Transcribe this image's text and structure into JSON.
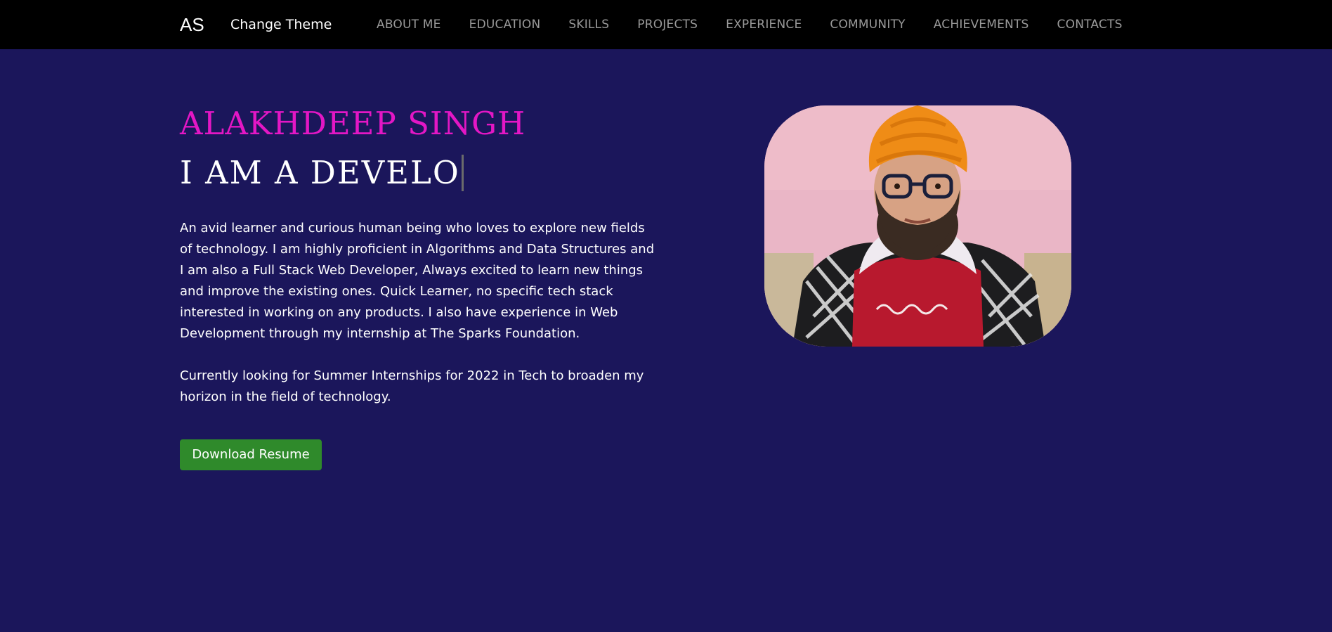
{
  "navbar": {
    "brand": "AS",
    "theme_toggle": "Change Theme",
    "links": [
      "ABOUT ME",
      "EDUCATION",
      "SKILLS",
      "PROJECTS",
      "EXPERIENCE",
      "COMMUNITY",
      "ACHIEVEMENTS",
      "CONTACTS"
    ]
  },
  "hero": {
    "name": "ALAKHDEEP SINGH",
    "typing_text": "I AM A DEVELO",
    "bio": "An avid learner and curious human being who loves to explore new fields of technology. I am highly proficient in Algorithms and Data Structures and I am also a Full Stack Web Developer, Always excited to learn new things and improve the existing ones. Quick Learner, no specific tech stack interested in working on any products. I also have experience in Web Development through my internship at The Sparks Foundation.",
    "seeking": "Currently looking for Summer Internships for 2022 in Tech to broaden my horizon in the field of technology.",
    "resume_button": "Download Resume"
  },
  "colors": {
    "background": "#1b165b",
    "navbar": "#000000",
    "name_accent": "#e317c5",
    "button": "#2f8a2b",
    "nav_link": "#9a9a9a"
  }
}
